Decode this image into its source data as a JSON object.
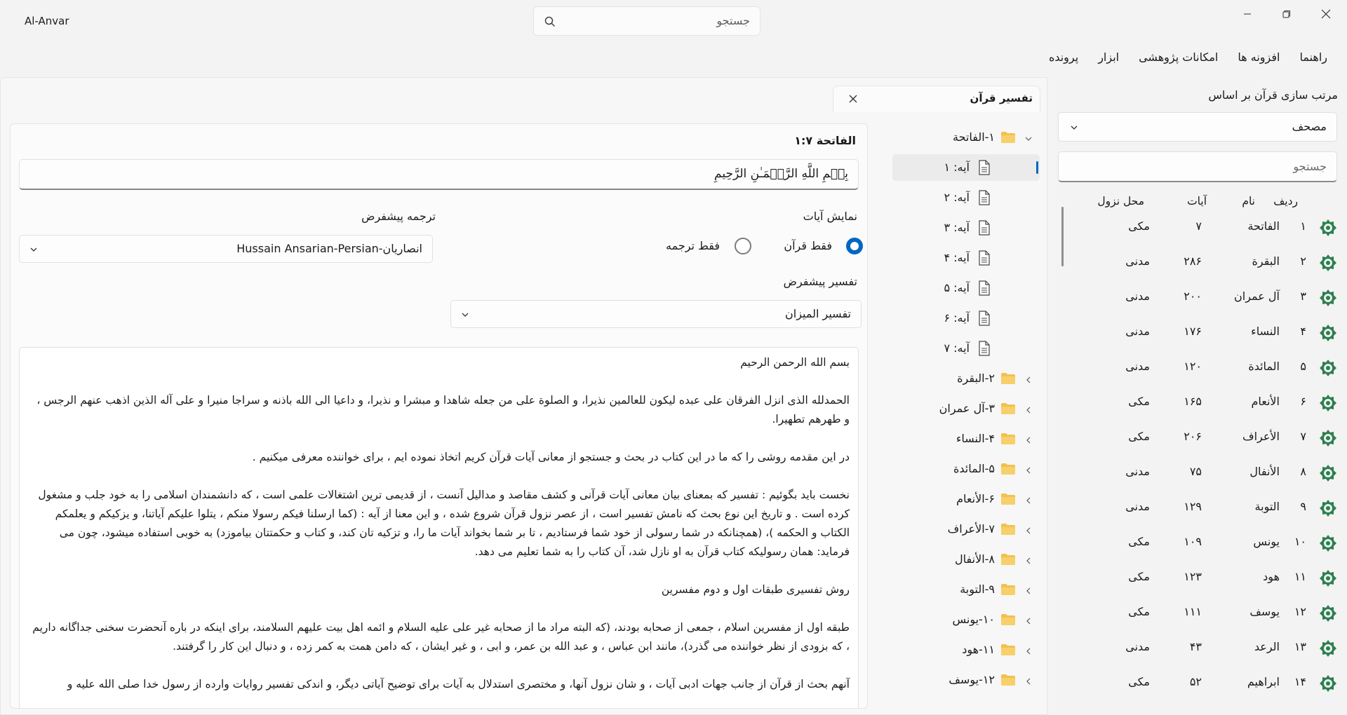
{
  "app": {
    "title": "Al-Anvar"
  },
  "top_search": {
    "placeholder": "جستجو"
  },
  "menu": [
    "پرونده",
    "ابزار",
    "امکانات پژوهشی",
    "افزونه ها",
    "راهنما"
  ],
  "tab": {
    "label": "تفسیر قرآن"
  },
  "tree": {
    "expanded_surah": "۱-الفاتحة",
    "ayahs": [
      "آیه: ۱",
      "آیه: ۲",
      "آیه: ۳",
      "آیه: ۴",
      "آیه: ۵",
      "آیه: ۶",
      "آیه: ۷"
    ],
    "selected_index": 0,
    "collapsed_surahs": [
      "۲-البقرة",
      "۳-آل عمران",
      "۴-النساء",
      "۵-المائدة",
      "۶-الأنعام",
      "۷-الأعراف",
      "۸-الأنفال",
      "۹-التوبة",
      "۱۰-یونس",
      "۱۱-هود",
      "۱۲-یوسف"
    ]
  },
  "content": {
    "verse_ref": "الفاتحة ۱:۷",
    "verse_text": "بِسۡمِ اللَّهِ الرَّحۡمَـٰنِ الرَّحِيمِ",
    "display_label": "نمایش آیات",
    "radio_quran_only": "فقط قرآن",
    "radio_translation_only": "فقط ترجمه",
    "default_translation_label": "ترجمه پیشفرض",
    "default_translation_value": "انصاریان-Hussain Ansarian-Persian",
    "default_tafsir_label": "تفسیر پیشفرض",
    "default_tafsir_value": "تفسیر المیزان",
    "tafsir_paragraphs": [
      "بسم الله الرحمن الرحیم",
      "الحمدلله الذی انزل الفرقان علی عبده لیکون للعالمین نذیرا، و الصلوة علی من جعله شاهدا و مبشرا و نذیرا، و داعیا الی الله باذنه و سراجا منیرا و علی آله الذین اذهب عنهم الرجس ، و طهرهم تطهیرا.",
      "در این مقدمه روشی را که ما در این کتاب در بحث و جستجو از معانی آیات قرآن کریم اتخاذ نموده ایم ، برای خواننده معرفی میکنیم .",
      "نخست باید بگوئیم : تفسیر که بمعنای بیان معانی آیات قرآنی و کشف مقاصد و مدالیل آنست ، از قدیمی ترین اشتغالات علمی است ، که دانشمندان اسلامی را به خود جلب و مشغول کرده است . و تاریخ این نوع بحث که نامش تفسیر است ، از عصر نزول قرآن شروع شده ، و این معنا از آیه : (کما ارسلنا فیکم رسولا منکم ، یتلوا علیکم آیاتنا، و یزکیکم و یعلمکم الکتاب و الحکمه )، (همچنانکه در شما رسولی از خود شما فرستادیم ، تا بر شما بخواند آیات ما را، و تزکیه تان کند، و کتاب و حکمتتان بیاموزد) به خوبی استفاده میشود، چون می فرماید: همان رسولیکه کتاب قرآن به او نازل شد، آن کتاب را به شما تعلیم می دهد.",
      "روش تفسیری طبقات اول و دوم مفسرین",
      "طبقه اول از مفسرین اسلام ، جمعی از صحابه بودند، (که البته مراد ما از صحابه غیر علی علیه السلام و ائمه اهل بیت علیهم السلامند، برای اینکه در باره آنحضرت سخنی جداگانه داریم ، که بزودی از نظر خواننده می گذرد)، مانند ابن عباس ، و عبد الله بن عمر، و ابی ، و غیر ایشان ، که دامن همت به کمر زده ، و دنبال این کار را گرفتند.",
      "آنهم بحث از قرآن از جانب جهات ادبی آیات ، و شان نزول آنها، و مختصری استدلال به آیات برای توضیح آیاتی دیگر، و اندکی تفسیر روایات وارده از رسول خدا صلی الله علیه و"
    ]
  },
  "sidebar": {
    "title": "مرتب سازی قرآن بر اساس",
    "sort_value": "مصحف",
    "search_placeholder": "جستجو",
    "headers": {
      "index": "ردیف",
      "name": "نام",
      "ayat": "آیات",
      "place": "محل نزول"
    },
    "rows": [
      {
        "index": "۱",
        "name": "الفاتحة",
        "ayat": "۷",
        "place": "مکی"
      },
      {
        "index": "۲",
        "name": "البقرة",
        "ayat": "۲۸۶",
        "place": "مدنی"
      },
      {
        "index": "۳",
        "name": "آل عمران",
        "ayat": "۲۰۰",
        "place": "مدنی"
      },
      {
        "index": "۴",
        "name": "النساء",
        "ayat": "۱۷۶",
        "place": "مدنی"
      },
      {
        "index": "۵",
        "name": "المائدة",
        "ayat": "۱۲۰",
        "place": "مدنی"
      },
      {
        "index": "۶",
        "name": "الأنعام",
        "ayat": "۱۶۵",
        "place": "مکی"
      },
      {
        "index": "۷",
        "name": "الأعراف",
        "ayat": "۲۰۶",
        "place": "مکی"
      },
      {
        "index": "۸",
        "name": "الأنفال",
        "ayat": "۷۵",
        "place": "مدنی"
      },
      {
        "index": "۹",
        "name": "التوبة",
        "ayat": "۱۲۹",
        "place": "مدنی"
      },
      {
        "index": "۱۰",
        "name": "یونس",
        "ayat": "۱۰۹",
        "place": "مکی"
      },
      {
        "index": "۱۱",
        "name": "هود",
        "ayat": "۱۲۳",
        "place": "مکی"
      },
      {
        "index": "۱۲",
        "name": "یوسف",
        "ayat": "۱۱۱",
        "place": "مکی"
      },
      {
        "index": "۱۳",
        "name": "الرعد",
        "ayat": "۴۳",
        "place": "مدنی"
      },
      {
        "index": "۱۴",
        "name": "ابراهيم",
        "ayat": "۵۲",
        "place": "مکی"
      }
    ]
  },
  "colors": {
    "accent": "#0067c0",
    "folder": "#f2c14e",
    "badge": "#2e7d4f"
  }
}
